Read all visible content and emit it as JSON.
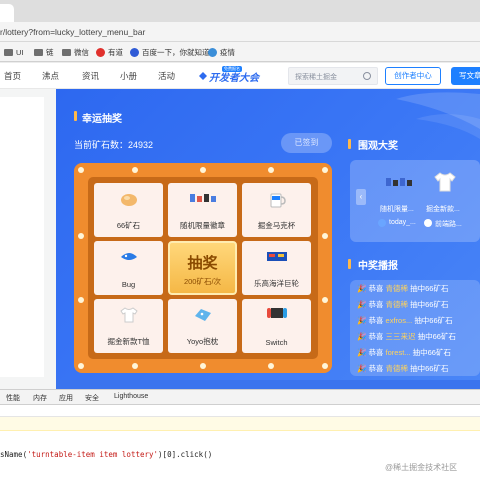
{
  "browser": {
    "url": "r/lottery?from=lucky_lottery_menu_bar",
    "bookmarks": [
      {
        "label": "UI",
        "icon": "folder-icon"
      },
      {
        "label": "链",
        "icon": "folder-icon"
      },
      {
        "label": "微信",
        "icon": "folder-icon"
      },
      {
        "label": "有道",
        "icon": "youdao-icon"
      },
      {
        "label": "百度一下，你就知道",
        "icon": "baidu-icon"
      },
      {
        "label": "疫情",
        "icon": "globe-icon"
      }
    ]
  },
  "header": {
    "nav": [
      "首页",
      "沸点",
      "资讯",
      "小册",
      "活动"
    ],
    "logo_text": "开发者大会",
    "logo_badge": "免费报名",
    "search_placeholder": "探索稀土掘金",
    "creator_button": "创作者中心",
    "write_button": "写文章"
  },
  "lottery": {
    "title": "幸运抽奖",
    "ore_label": "当前矿石数：",
    "ore_count": "24932",
    "signed_button": "已签到",
    "prizes": [
      {
        "label": "66矿石",
        "icon": "ore-icon"
      },
      {
        "label": "随机限量徽章",
        "icon": "badge-icon"
      },
      {
        "label": "掘金马克杯",
        "icon": "mug-icon"
      },
      {
        "label": "Bug",
        "icon": "bug-icon"
      },
      {
        "label": "乐高海洋巨轮",
        "icon": "lego-ship-icon"
      },
      {
        "label": "掘金新款T恤",
        "icon": "tshirt-icon"
      },
      {
        "label": "Yoyo抱枕",
        "icon": "pillow-icon"
      },
      {
        "label": "Switch",
        "icon": "switch-icon"
      }
    ],
    "draw_button": "抽奖",
    "draw_cost": "200矿石/次"
  },
  "spectate": {
    "title": "围观大奖",
    "items": [
      {
        "label": "随机限量...",
        "user": "today_..."
      },
      {
        "label": "掘金新款...",
        "user": "前端路..."
      }
    ]
  },
  "broadcast": {
    "title": "中奖播报",
    "entries": [
      {
        "prefix": "恭喜",
        "user": "青德稀",
        "text": "抽中66矿石"
      },
      {
        "prefix": "恭喜",
        "user": "青德稀",
        "text": "抽中66矿石"
      },
      {
        "prefix": "恭喜",
        "user": "exfros...",
        "text": "抽中66矿石"
      },
      {
        "prefix": "恭喜",
        "user": "三三来迟",
        "text": "抽中66矿石"
      },
      {
        "prefix": "恭喜",
        "user": "forest...",
        "text": "抽中66矿石"
      },
      {
        "prefix": "恭喜",
        "user": "青德稀",
        "text": "抽中66矿石"
      }
    ]
  },
  "devtools": {
    "tabs": [
      "性能",
      "内存",
      "应用",
      "安全",
      "Lighthouse"
    ],
    "code_prefix": "sName(",
    "code_string": "'turntable-item item lottery'",
    "code_suffix": ")[0].click()"
  },
  "watermark": "@稀土掘金技术社区",
  "colors": {
    "accent": "#1e80ff",
    "page_blue": "#2d68f0",
    "board_orange": "#f08c2e",
    "gold": "#ffd35c"
  }
}
